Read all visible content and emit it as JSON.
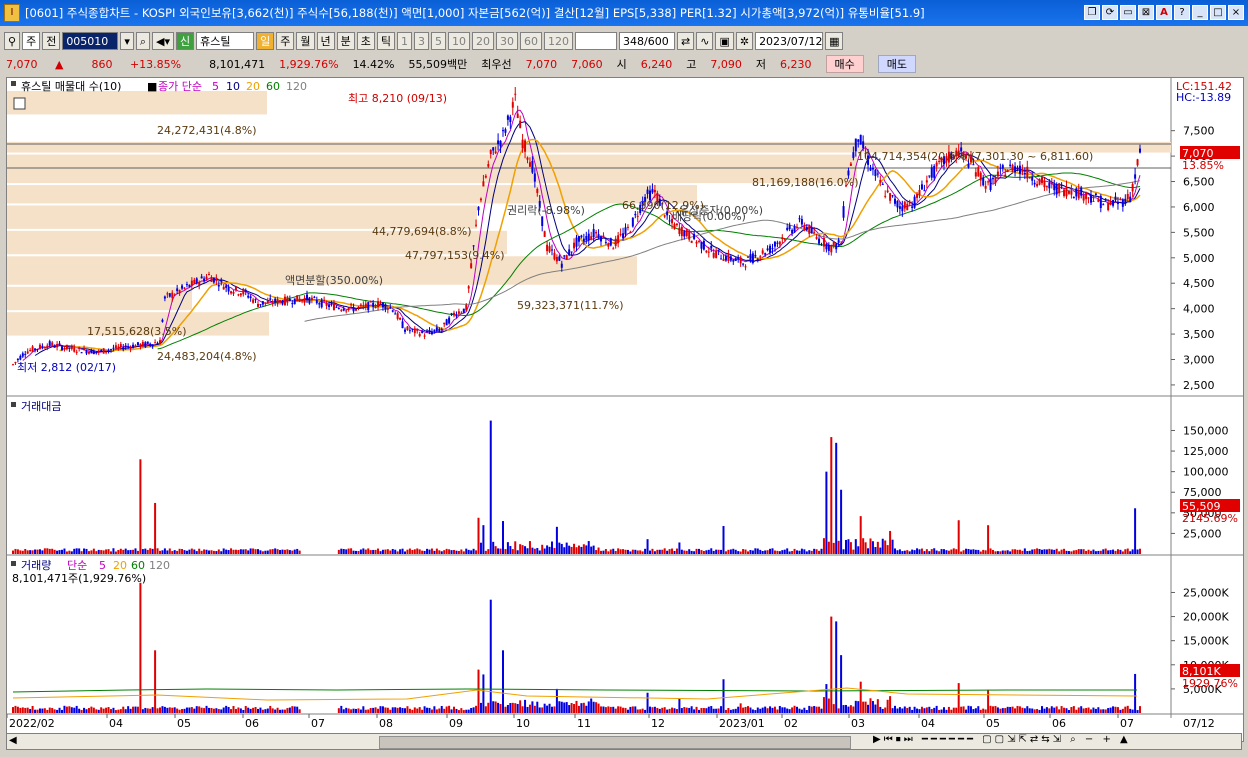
{
  "window": {
    "title": "[0601] 주식종합차트 - KOSPI 외국인보유[3,662(천)] 주식수[56,188(천)] 액면[1,000] 자본금[562(억)] 결산[12월] EPS[5,338] PER[1.32] 시가총액[3,972(억)] 유통비율[51.9]",
    "app_icon": "I",
    "buttons": [
      "❐",
      "⟳",
      "▭",
      "⊠",
      "A",
      "?",
      "_",
      "□",
      "×"
    ]
  },
  "toolbar": {
    "market": "주",
    "prev": "전",
    "code": "005010",
    "name_prefix": "신",
    "stock_name": "휴스틸",
    "periods": [
      "일",
      "주",
      "월",
      "년",
      "분",
      "초",
      "틱"
    ],
    "counts": [
      "1",
      "3",
      "5",
      "10",
      "20",
      "30",
      "60",
      "120"
    ],
    "count_field": "",
    "bars": "348",
    "bars_total": "/600",
    "date": "2023/07/12"
  },
  "quote": {
    "price": "7,070",
    "arrow": "▲",
    "change": "860",
    "change_pct": "+13.85%",
    "volume": "8,101,471",
    "volume_pct": "1,929.76%",
    "turnover_pct": "14.42%",
    "amount": "55,509백만",
    "best_label": "최우선",
    "ask": "7,070",
    "bid": "7,060",
    "open_label": "시",
    "open": "6,240",
    "high_label": "고",
    "high": "7,090",
    "low_label": "저",
    "low": "6,230",
    "buy_label": "매수",
    "sell_label": "매도"
  },
  "price_panel": {
    "legend_title": "휴스틸 매물대 수(10)",
    "ma_label": "종가 단순",
    "ma_periods": [
      "5",
      "10",
      "20",
      "60",
      "120"
    ],
    "lc": "LC:151.42",
    "hc": "HC:-13.89",
    "last_price": "7,070",
    "last_pct": "13.85%",
    "high_marker": "최고 8,210 (09/13)",
    "low_marker": "최저 2,812 (02/17)",
    "events": [
      "액면분할(350.00%)",
      "권리락(-8.98%)",
      "배당락(0.00%)",
      "유상증자(0.00%)"
    ],
    "y_ticks": [
      "7,500",
      "7,000",
      "6,500",
      "6,000",
      "5,500",
      "5,000",
      "4,500",
      "4,000",
      "3,500",
      "3,000",
      "2,500"
    ]
  },
  "volume_profile": [
    {
      "label": "24,272,431(4.8%)"
    },
    {
      "label": "104,714,354(20.6%)(7,301.30 ~ 6,811.60)"
    },
    {
      "label": "81,169,188(16.0%)"
    },
    {
      "label": "66,390(12.9%)"
    },
    {
      "label": "44,779,694(8.8%)"
    },
    {
      "label": "47,797,153(9.4%)"
    },
    {
      "label": "59,323,371(11.7%)"
    },
    {
      "label": "17,515,628(3.5%)"
    },
    {
      "label": "24,483,204(4.8%)"
    }
  ],
  "amount_panel": {
    "title": "거래대금",
    "last_value": "55,509",
    "last_pct": "2145.69%",
    "y_ticks": [
      "150,000",
      "125,000",
      "100,000",
      "75,000",
      "50,000",
      "25,000"
    ]
  },
  "volume_panel": {
    "title": "거래량",
    "ma_label": "단순",
    "ma_periods": [
      "5",
      "20",
      "60",
      "120"
    ],
    "info": "8,101,471주(1,929.76%)",
    "last_value": "8,101K",
    "last_pct": "1929.76%",
    "y_ticks": [
      "25,000K",
      "20,000K",
      "15,000K",
      "10,000K",
      "5,000K"
    ]
  },
  "x_axis": {
    "labels": [
      "2022/02",
      "04",
      "05",
      "06",
      "07",
      "08",
      "09",
      "10",
      "11",
      "12",
      "2023/01",
      "02",
      "03",
      "04",
      "05",
      "06",
      "07"
    ],
    "right_label": "07/12"
  },
  "colors": {
    "up": "#e00000",
    "down": "#0000e0",
    "ma5": "#c000c0",
    "ma10": "#000080",
    "ma20": "#f0a000",
    "ma60": "#008000",
    "ma120": "#808080",
    "profile": "#f5e1c8"
  },
  "chart_data": {
    "type": "candlestick",
    "title": "휴스틸",
    "price_range": [
      2400,
      8300
    ],
    "last_close": 7070,
    "high": {
      "value": 8210,
      "date": "09/13"
    },
    "low": {
      "value": 2812,
      "date": "02/17"
    },
    "volume_profile": [
      {
        "value": 24272431,
        "pct": 4.8
      },
      {
        "value": 104714354,
        "pct": 20.6,
        "range": [
          6811.6,
          7301.3
        ]
      },
      {
        "value": 81169188,
        "pct": 16.0
      },
      {
        "value": 44779694,
        "pct": 8.8
      },
      {
        "value": 47797153,
        "pct": 9.4
      },
      {
        "value": 59323371,
        "pct": 11.7
      },
      {
        "value": 17515628,
        "pct": 3.5
      },
      {
        "value": 24483204,
        "pct": 4.8
      }
    ],
    "price_path": [
      [
        0,
        2900
      ],
      [
        5,
        3150
      ],
      [
        15,
        3300
      ],
      [
        25,
        3200
      ],
      [
        35,
        3150
      ],
      [
        45,
        3250
      ],
      [
        55,
        3300
      ],
      [
        60,
        3350
      ],
      [
        62,
        4200
      ],
      [
        70,
        4400
      ],
      [
        80,
        4650
      ],
      [
        88,
        4400
      ],
      [
        95,
        4300
      ],
      [
        100,
        4100
      ],
      [
        110,
        4150
      ],
      [
        120,
        4200
      ],
      [
        130,
        4050
      ],
      [
        140,
        4000
      ],
      [
        150,
        4100
      ],
      [
        155,
        4000
      ],
      [
        160,
        3600
      ],
      [
        168,
        3500
      ],
      [
        175,
        3600
      ],
      [
        180,
        3900
      ],
      [
        185,
        4000
      ],
      [
        190,
        6000
      ],
      [
        195,
        7000
      ],
      [
        200,
        7400
      ],
      [
        205,
        8100
      ],
      [
        208,
        7300
      ],
      [
        212,
        6800
      ],
      [
        218,
        5200
      ],
      [
        224,
        4900
      ],
      [
        230,
        5300
      ],
      [
        238,
        5500
      ],
      [
        245,
        5250
      ],
      [
        252,
        5600
      ],
      [
        258,
        6200
      ],
      [
        262,
        6300
      ],
      [
        268,
        5700
      ],
      [
        274,
        5500
      ],
      [
        280,
        5300
      ],
      [
        286,
        5100
      ],
      [
        292,
        5000
      ],
      [
        298,
        4900
      ],
      [
        304,
        5050
      ],
      [
        310,
        5200
      ],
      [
        316,
        5500
      ],
      [
        322,
        5700
      ],
      [
        328,
        5400
      ],
      [
        334,
        5200
      ],
      [
        338,
        5300
      ],
      [
        340,
        6500
      ],
      [
        345,
        7400
      ],
      [
        350,
        6800
      ],
      [
        356,
        6300
      ],
      [
        362,
        6000
      ],
      [
        368,
        6100
      ],
      [
        374,
        6600
      ],
      [
        380,
        6900
      ],
      [
        386,
        7100
      ],
      [
        392,
        6800
      ],
      [
        398,
        6400
      ],
      [
        404,
        6700
      ],
      [
        410,
        6800
      ],
      [
        416,
        6600
      ],
      [
        422,
        6400
      ],
      [
        428,
        6350
      ],
      [
        434,
        6300
      ],
      [
        440,
        6200
      ],
      [
        446,
        6050
      ],
      [
        452,
        6100
      ],
      [
        456,
        6200
      ],
      [
        460,
        7070
      ]
    ]
  }
}
